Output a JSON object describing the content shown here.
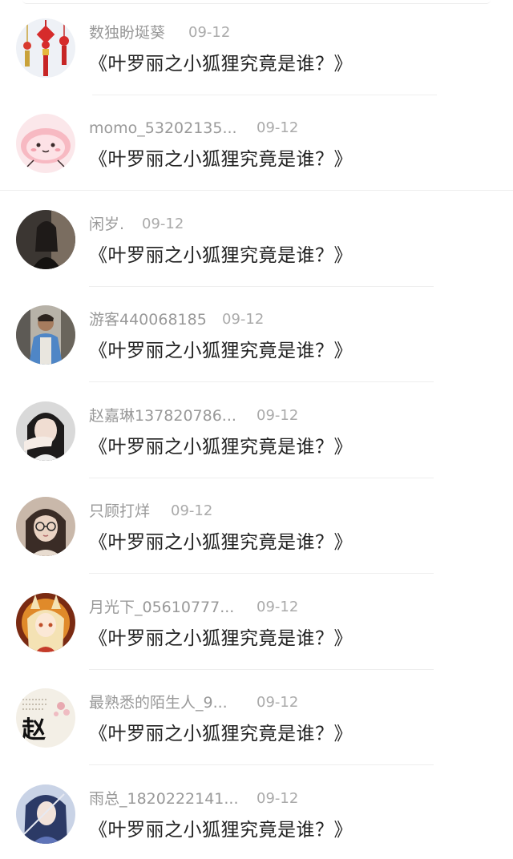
{
  "comments": [
    {
      "username": "数独盼埏葵",
      "date": "09-12",
      "text": "《叶罗丽之小狐狸究竟是谁？》",
      "avatar_icon": "chinese-knot-icon"
    },
    {
      "username": "momo_53202135...",
      "date": "09-12",
      "text": "《叶罗丽之小狐狸究竟是谁？》",
      "avatar_icon": "pink-cartoon-face-icon"
    },
    {
      "username": "闲岁.",
      "date": "09-12",
      "text": "《叶罗丽之小狐狸究竟是谁？》",
      "avatar_icon": "dark-portrait-icon"
    },
    {
      "username": "游客440068185",
      "date": "09-12",
      "text": "《叶罗丽之小狐狸究竟是谁？》",
      "avatar_icon": "street-person-icon"
    },
    {
      "username": "赵嘉琳137820786...",
      "date": "09-12",
      "text": "《叶罗丽之小狐狸究竟是谁？》",
      "avatar_icon": "girl-hiding-face-icon"
    },
    {
      "username": "只顾打烊",
      "date": "09-12",
      "text": "《叶罗丽之小狐狸究竟是谁？》",
      "avatar_icon": "girl-with-glasses-icon"
    },
    {
      "username": "月光下_05610777...",
      "date": "09-12",
      "text": "《叶罗丽之小狐狸究竟是谁？》",
      "avatar_icon": "anime-fox-girl-icon"
    },
    {
      "username": "最熟悉的陌生人_9...",
      "date": "09-12",
      "text": "《叶罗丽之小狐狸究竟是谁？》",
      "avatar_icon": "calligraphy-zhao-icon",
      "avatar_glyph": "赵"
    },
    {
      "username": "雨总_1820222141...",
      "date": "09-12",
      "text": "《叶罗丽之小狐狸究竟是谁？》",
      "avatar_icon": "anime-swordsman-icon"
    }
  ]
}
